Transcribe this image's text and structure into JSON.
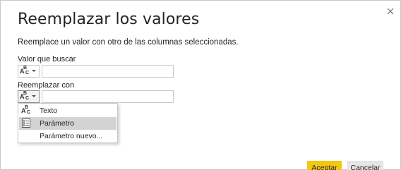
{
  "dialog": {
    "title": "Reemplazar los valores",
    "subtitle": "Reemplace un valor con otro de las columnas seleccionadas."
  },
  "fields": {
    "find_label": "Valor que buscar",
    "find_value": "",
    "replace_label": "Reemplazar con",
    "replace_value": ""
  },
  "type_menu": {
    "items": [
      {
        "label": "Texto",
        "icon": "abc-text-icon"
      },
      {
        "label": "Parámetro",
        "icon": "parameter-icon"
      },
      {
        "label": "Parámetro nuevo...",
        "icon": ""
      }
    ],
    "highlighted_index": 1
  },
  "buttons": {
    "ok_label": "Aceptar",
    "cancel_label": "Cancelar"
  },
  "colors": {
    "accent": "#f2c811",
    "border": "#c8c8c8",
    "hover": "#d3d3d3",
    "secondary_button": "#e6e6e6"
  }
}
